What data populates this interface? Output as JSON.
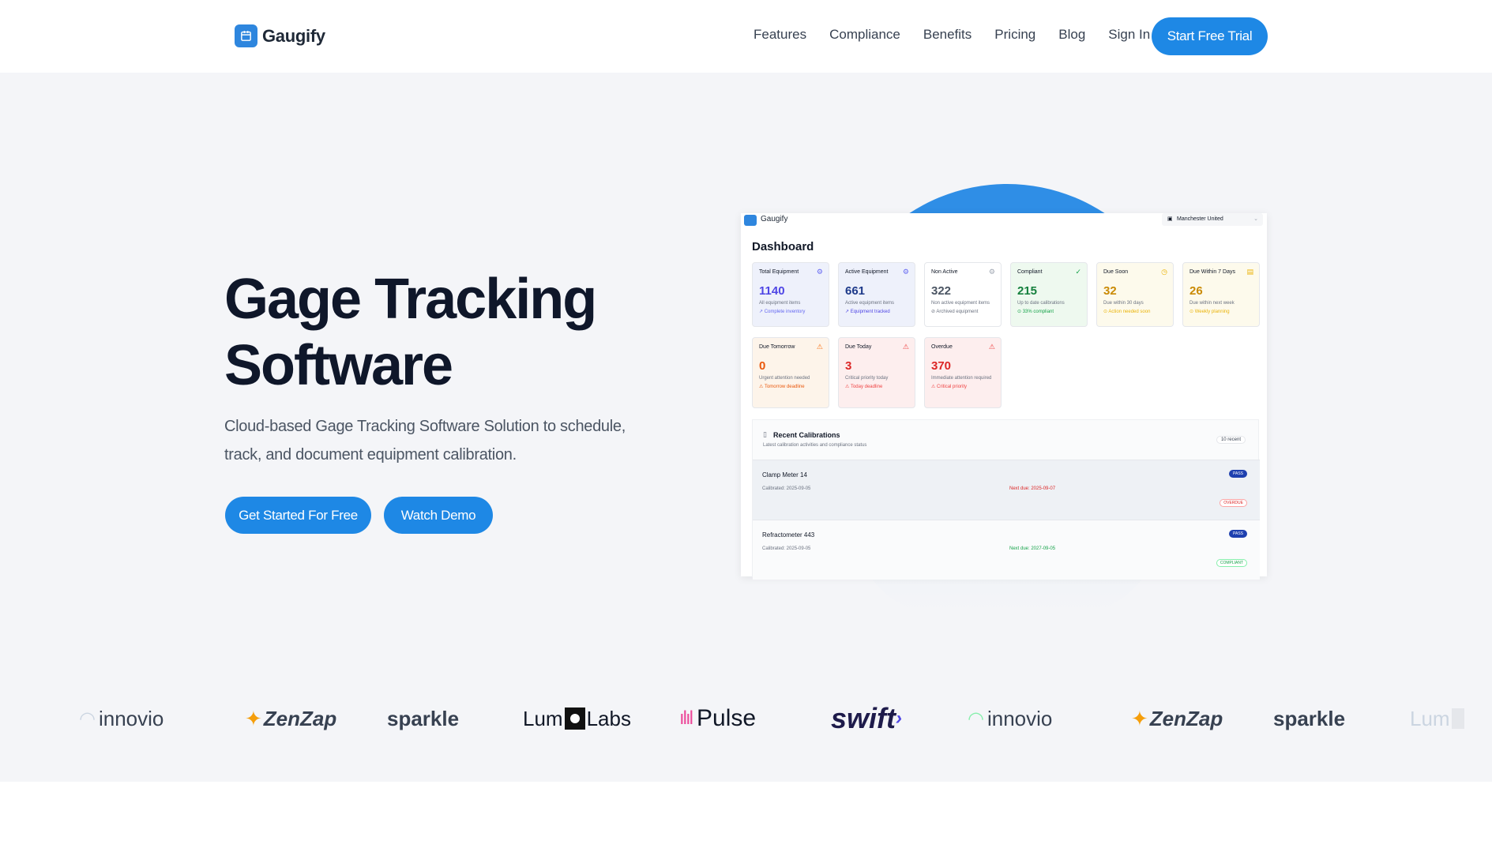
{
  "brand": {
    "name": "Gaugify"
  },
  "nav": {
    "links": [
      "Features",
      "Compliance",
      "Benefits",
      "Pricing",
      "Blog",
      "Sign In"
    ],
    "cta": "Start Free Trial"
  },
  "hero": {
    "title_line1": "Gage Tracking",
    "title_line2": "Software",
    "subtitle_line1": "Cloud-based Gage Tracking Software Solution to schedule,",
    "subtitle_line2": "track, and document equipment calibration.",
    "primary_cta": "Get Started For Free",
    "secondary_cta": "Watch Demo"
  },
  "dashboard": {
    "brand": "Gaugify",
    "org": "Manchester United",
    "title": "Dashboard",
    "cards": [
      {
        "label": "Total Equipment",
        "value": "1140",
        "desc": "All equipment items",
        "foot": "↗ Complete inventory"
      },
      {
        "label": "Active Equipment",
        "value": "661",
        "desc": "Active equipment items",
        "foot": "↗ Equipment tracked"
      },
      {
        "label": "Non Active",
        "value": "322",
        "desc": "Non active equipment items",
        "foot": "⊘ Archived equipment"
      },
      {
        "label": "Compliant",
        "value": "215",
        "desc": "Up to date calibrations",
        "foot": "⊙ 33% compliant"
      },
      {
        "label": "Due Soon",
        "value": "32",
        "desc": "Due within 30 days",
        "foot": "⊙ Action needed soon"
      },
      {
        "label": "Due Within 7 Days",
        "value": "26",
        "desc": "Due within next week",
        "foot": "⊙ Weekly planning"
      },
      {
        "label": "Due Tomorrow",
        "value": "0",
        "desc": "Urgent attention needed",
        "foot": "⚠ Tomorrow deadline"
      },
      {
        "label": "Due Today",
        "value": "3",
        "desc": "Critical priority today",
        "foot": "⚠ Today deadline"
      },
      {
        "label": "Overdue",
        "value": "370",
        "desc": "Immediate attention required",
        "foot": "⚠ Critical priority"
      }
    ],
    "recent": {
      "title": "Recent Calibrations",
      "subtitle": "Latest calibration activities and compliance status",
      "badge": "10 recent",
      "rows": [
        {
          "name": "Clamp Meter 14",
          "calibrated": "Calibrated: 2025-09-05",
          "next": "Next due: 2025-09-07",
          "result": "PASS",
          "status": "OVERDUE"
        },
        {
          "name": "Refractometer 443",
          "calibrated": "Calibrated: 2025-09-05",
          "next": "Next due: 2027-09-05",
          "result": "PASS",
          "status": "COMPLIANT"
        }
      ]
    }
  },
  "logos": [
    "innovio",
    "ZenZap",
    "sparkle",
    "Lum",
    "Labs",
    "Pulse",
    "swift",
    "innovio",
    "ZenZap",
    "sparkle",
    "Lum"
  ],
  "colors": {
    "accent": "#1e88e5",
    "hero_bg": "#f4f5f8"
  }
}
